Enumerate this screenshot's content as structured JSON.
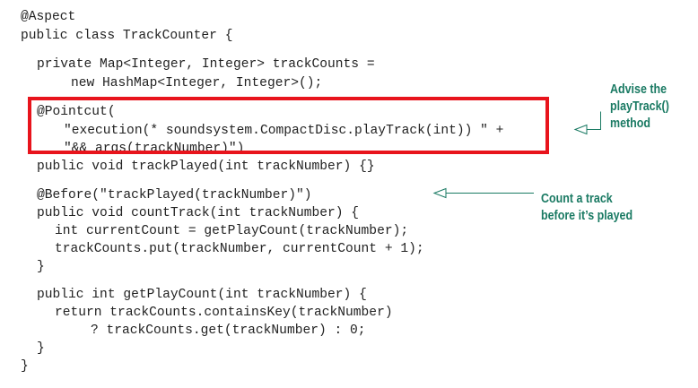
{
  "code": {
    "lines": [
      "@Aspect",
      "public class TrackCounter {",
      "private Map<Integer, Integer> trackCounts =",
      "new HashMap<Integer, Integer>();",
      "@Pointcut(",
      "\"execution(* soundsystem.CompactDisc.playTrack(int)) \" +",
      "\"&& args(trackNumber)\")",
      "public void trackPlayed(int trackNumber) {}",
      "@Before(\"trackPlayed(trackNumber)\")",
      "public void countTrack(int trackNumber) {",
      "int currentCount = getPlayCount(trackNumber);",
      "trackCounts.put(trackNumber, currentCount + 1);",
      "}",
      "public int getPlayCount(int trackNumber) {",
      "return trackCounts.containsKey(trackNumber)",
      "? trackCounts.get(trackNumber) : 0;",
      "}",
      "}"
    ]
  },
  "callouts": {
    "pointcut": [
      "Advise the",
      "playTrack()",
      "method"
    ],
    "before": [
      "Count a track",
      "before it’s played"
    ]
  },
  "colors": {
    "highlight": "#e8141c",
    "callout_text": "#1a7a63",
    "arrow": "#1a7a63",
    "code_text": "#222222"
  }
}
